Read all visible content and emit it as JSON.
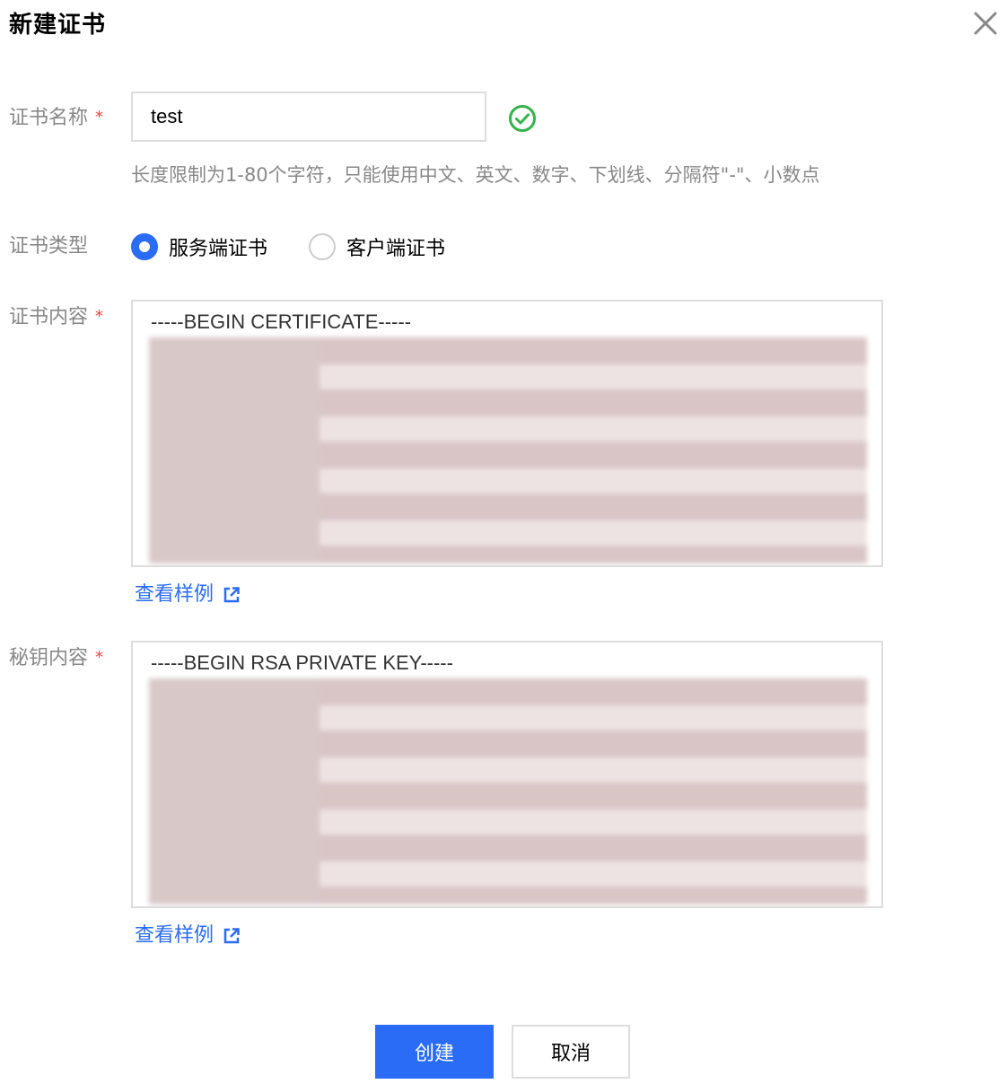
{
  "dialog": {
    "title": "新建证书"
  },
  "form": {
    "name": {
      "label": "证书名称",
      "value": "test",
      "hint": "长度限制为1-80个字符，只能使用中文、英文、数字、下划线、分隔符\"-\"、小数点"
    },
    "type": {
      "label": "证书类型",
      "options": [
        "服务端证书",
        "客户端证书"
      ],
      "selected": "服务端证书"
    },
    "cert": {
      "label": "证书内容",
      "first_line": "-----BEGIN CERTIFICATE-----",
      "link": "查看样例"
    },
    "key": {
      "label": "秘钥内容",
      "first_line": "-----BEGIN RSA PRIVATE KEY-----",
      "link": "查看样例"
    },
    "required_mark": "*"
  },
  "buttons": {
    "create": "创建",
    "cancel": "取消"
  },
  "colors": {
    "primary": "#2a6cf6",
    "required": "#e54545",
    "success": "#34b34a"
  },
  "icons": {
    "close": "close-icon",
    "valid": "check-circle-icon",
    "external": "external-link-icon"
  }
}
